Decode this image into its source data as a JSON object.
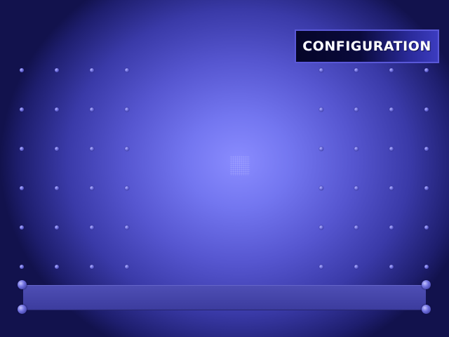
{
  "screen": {
    "title": "CONFIGURATION"
  },
  "status_bar": {
    "text": ""
  }
}
